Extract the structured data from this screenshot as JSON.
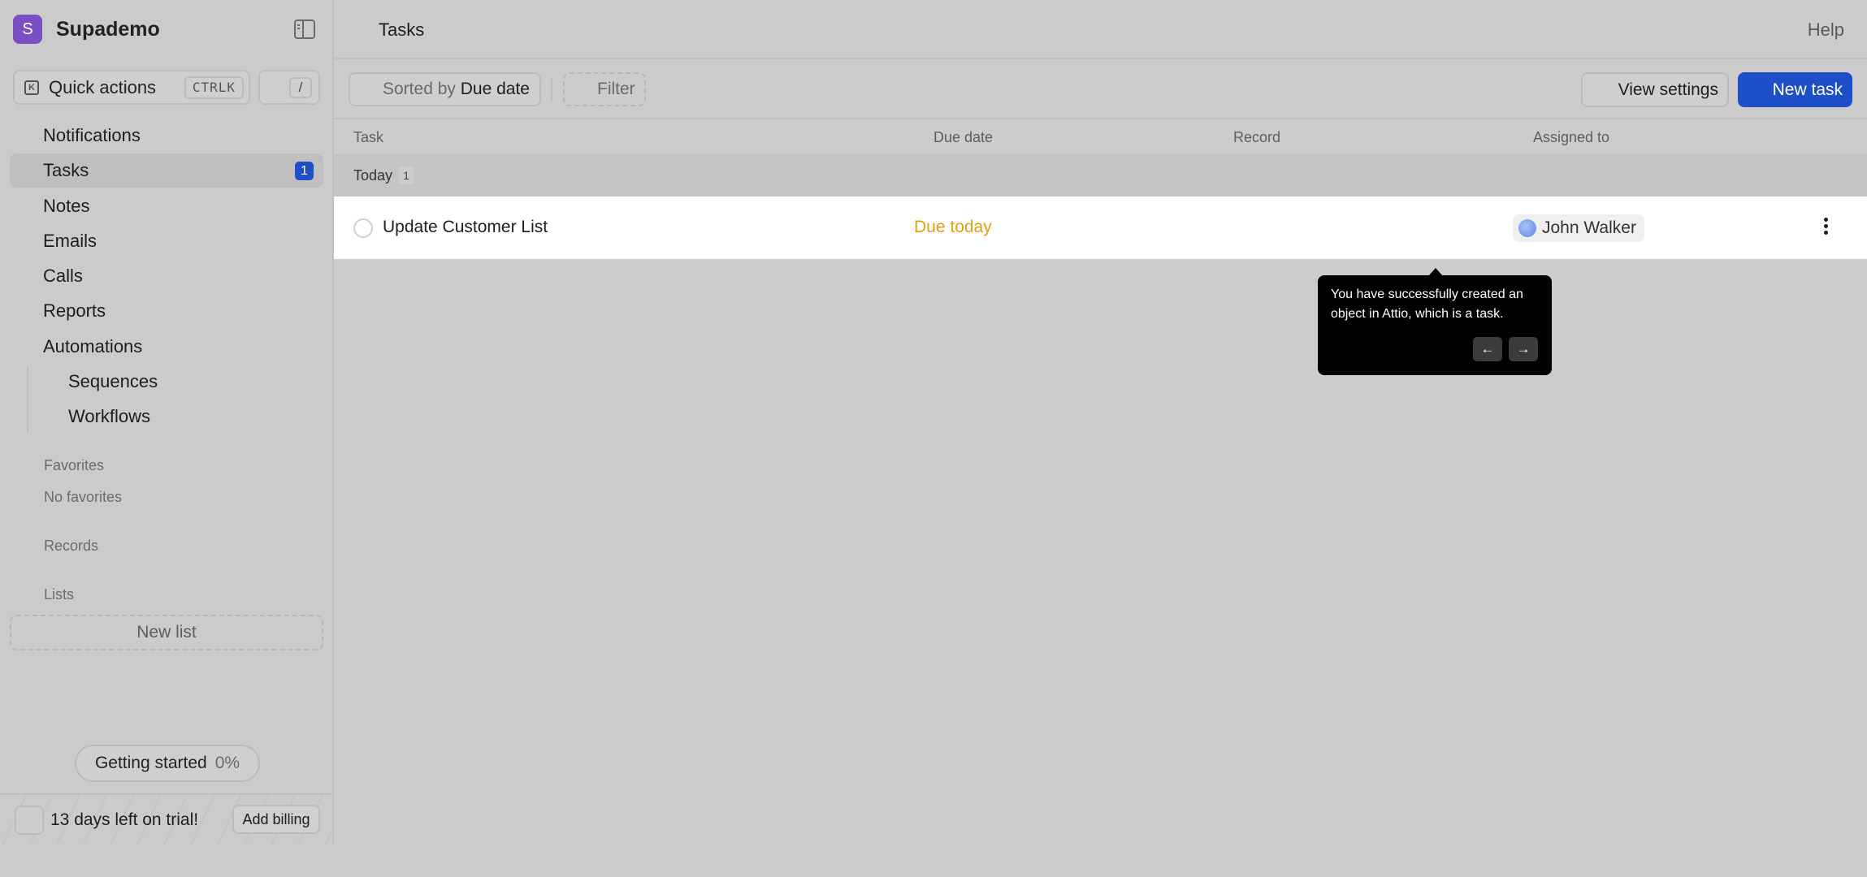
{
  "workspace": {
    "logo_letter": "S",
    "name": "Supademo",
    "brand_color": "#7a4fc4"
  },
  "quick_actions": {
    "label": "Quick actions",
    "shortcut": "CTRLK",
    "slash_key": "/"
  },
  "nav": [
    {
      "label": "Notifications"
    },
    {
      "label": "Tasks",
      "badge": "1",
      "active": true
    },
    {
      "label": "Notes"
    },
    {
      "label": "Emails"
    },
    {
      "label": "Calls"
    },
    {
      "label": "Reports"
    },
    {
      "label": "Automations"
    },
    {
      "label": "Sequences",
      "sub": true
    },
    {
      "label": "Workflows",
      "sub": true
    }
  ],
  "sections": {
    "favorites": "Favorites",
    "no_favorites": "No favorites",
    "records": "Records",
    "lists": "Lists",
    "new_list": "New list"
  },
  "getting_started": {
    "label": "Getting started",
    "percent": "0%"
  },
  "trial": {
    "text": "13 days left on trial!",
    "button": "Add billing"
  },
  "header": {
    "title": "Tasks",
    "help": "Help"
  },
  "toolbar": {
    "sort_prefix": "Sorted by",
    "sort_value": "Due date",
    "filter": "Filter",
    "view_settings": "View settings",
    "new_task": "New task",
    "accent_color": "#1d4fc9"
  },
  "columns": [
    "Task",
    "Due date",
    "Record",
    "Assigned to"
  ],
  "group": {
    "label": "Today",
    "count": "1"
  },
  "task": {
    "name": "Update Customer List",
    "due": "Due today",
    "due_color": "#e0a010",
    "record": "",
    "assignee": "John Walker"
  },
  "tooltip": {
    "text": "You have successfully created an object in Attio, which is a task.",
    "prev": "←",
    "next": "→"
  }
}
